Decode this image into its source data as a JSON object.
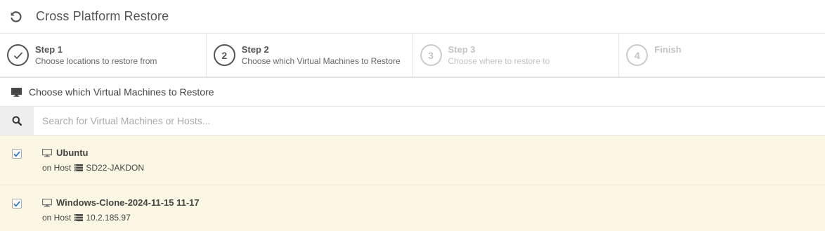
{
  "header": {
    "title": "Cross Platform Restore",
    "icon": "restore-icon"
  },
  "steps": [
    {
      "title": "Step 1",
      "desc": "Choose locations to restore from",
      "marker": "✓",
      "state": "done"
    },
    {
      "title": "Step 2",
      "desc": "Choose which Virtual Machines to Restore",
      "marker": "2",
      "state": "active"
    },
    {
      "title": "Step 3",
      "desc": "Choose where to restore to",
      "marker": "3",
      "state": "disabled"
    },
    {
      "title": "Finish",
      "desc": "",
      "marker": "4",
      "state": "disabled"
    }
  ],
  "section": {
    "label": "Choose which Virtual Machines to Restore",
    "icon": "monitor-icon"
  },
  "search": {
    "placeholder": "Search for Virtual Machines or Hosts...",
    "value": "",
    "icon": "search-icon"
  },
  "vms": [
    {
      "name": "Ubuntu",
      "host_prefix": "on Host",
      "host": "SD22-JAKDON",
      "checked": true
    },
    {
      "name": "Windows-Clone-2024-11-15 11-17",
      "host_prefix": "on Host",
      "host": "10.2.185.97",
      "checked": true
    }
  ],
  "colors": {
    "row_selected_bg": "#fcf6e4",
    "checkbox_check": "#2f77c2",
    "muted": "#c4c4c4"
  }
}
